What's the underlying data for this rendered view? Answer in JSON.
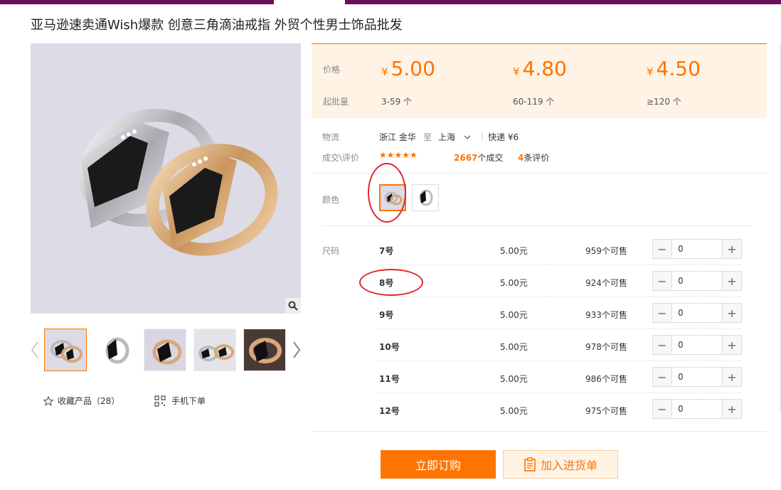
{
  "title": "亚马逊速卖通Wish爆款 创意三角滴油戒指 外贸个性男士饰品批发",
  "gallery": {
    "thumb_count": 5,
    "favorite_label": "收藏产品（28）",
    "mobile_label": "手机下单"
  },
  "pricing": {
    "price_label": "价格",
    "moq_label": "起批量",
    "currency_symbol": "¥",
    "tiers": [
      {
        "price": "5.00",
        "range": "3-59 个"
      },
      {
        "price": "4.80",
        "range": "60-119 个"
      },
      {
        "price": "4.50",
        "range": "≥120 个"
      }
    ]
  },
  "logistics": {
    "label": "物流",
    "from": "浙江 金华",
    "to_word": "至",
    "to": "上海",
    "shipping": "快递 ¥6"
  },
  "deals": {
    "label": "成交\\评价",
    "stars": "★★★★★",
    "deal_count": "2667",
    "deal_suffix": "个成交",
    "review_count": "4",
    "review_suffix": "条评价"
  },
  "color": {
    "label": "颜色"
  },
  "sizes": {
    "label": "尺码",
    "rows": [
      {
        "name": "7号",
        "price": "5.00元",
        "stock": "959个可售",
        "qty": "0"
      },
      {
        "name": "8号",
        "price": "5.00元",
        "stock": "924个可售",
        "qty": "0"
      },
      {
        "name": "9号",
        "price": "5.00元",
        "stock": "933个可售",
        "qty": "0"
      },
      {
        "name": "10号",
        "price": "5.00元",
        "stock": "978个可售",
        "qty": "0"
      },
      {
        "name": "11号",
        "price": "5.00元",
        "stock": "986个可售",
        "qty": "0"
      },
      {
        "name": "12号",
        "price": "5.00元",
        "stock": "975个可售",
        "qty": "0"
      }
    ]
  },
  "actions": {
    "buy_now": "立即订购",
    "add_to_list": "加入进货单"
  },
  "colors": {
    "accent": "#ff7300",
    "price_bg": "#fff3e6",
    "annotation": "#e0262c"
  }
}
